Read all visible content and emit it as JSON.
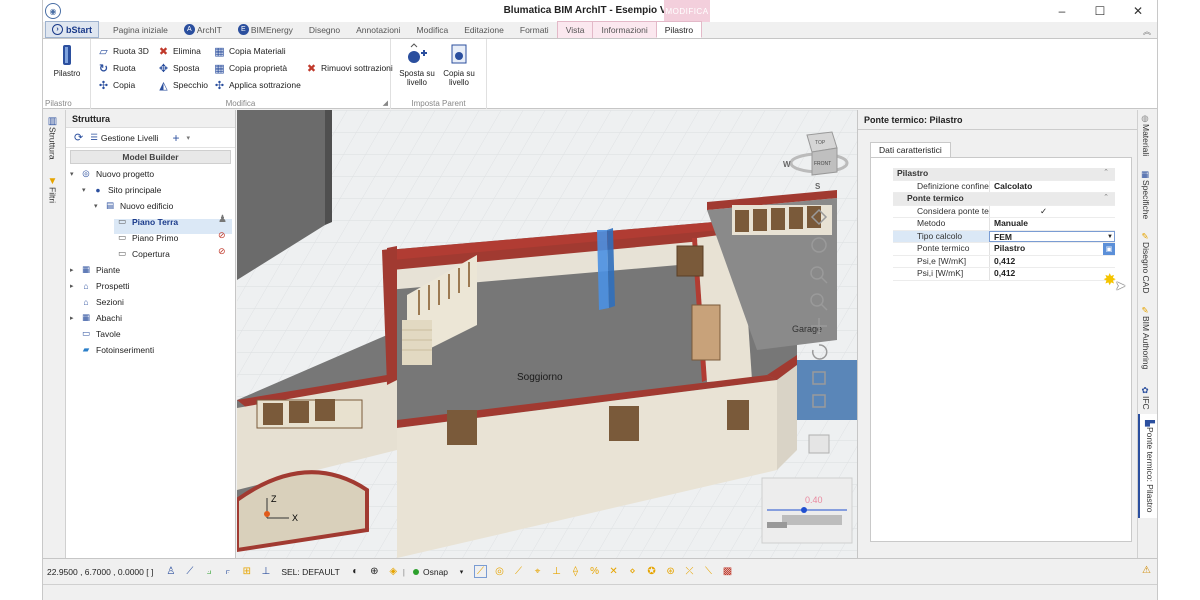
{
  "window": {
    "title": "Blumatica BIM ArchIT - Esempio Villetta*",
    "context_label": "MODIFICA",
    "controls": {
      "minimize": "–",
      "maximize": "☐",
      "close": "✕"
    }
  },
  "tabs": {
    "bstart": "bStart",
    "items": [
      "Pagina iniziale",
      "ArchIT",
      "BIMEnergy",
      "Disegno",
      "Annotazioni",
      "Modifica",
      "Editazione",
      "Formati",
      "Vista",
      "Informazioni",
      "Pilastro"
    ],
    "active": "Pilastro"
  },
  "ribbon": {
    "pilastro_group": {
      "button": "Pilastro",
      "label": "Pilastro"
    },
    "modifica_group": {
      "label": "Modifica",
      "ruota3d": "Ruota 3D",
      "ruota": "Ruota",
      "copia": "Copia",
      "elimina": "Elimina",
      "sposta": "Sposta",
      "specchio": "Specchio",
      "copia_materiali": "Copia Materiali",
      "copia_proprieta": "Copia proprietà",
      "applica_sottrazione": "Applica sottrazione",
      "rimuovi_sottrazioni": "Rimuovi sottrazioni"
    },
    "parent_group": {
      "label": "Imposta Parent",
      "sposta_livello": [
        "Sposta su",
        "livello"
      ],
      "copia_livello": [
        "Copia su",
        "livello"
      ]
    }
  },
  "left_tabs": [
    "Struttura",
    "Filtri"
  ],
  "struttura": {
    "title": "Struttura",
    "gestione_livelli": "Gestione Livelli",
    "model_builder": "Model Builder",
    "tree": {
      "nuovo_progetto": "Nuovo progetto",
      "sito_principale": "Sito principale",
      "nuovo_edificio": "Nuovo edificio",
      "piano_terra": "Piano Terra",
      "piano_primo": "Piano Primo",
      "copertura": "Copertura",
      "piante": "Piante",
      "prospetti": "Prospetti",
      "sezioni": "Sezioni",
      "abachi": "Abachi",
      "tavole": "Tavole",
      "fotoinserimenti": "Fotoinserimenti"
    }
  },
  "viewport": {
    "room_soggiorno": "Soggiorno",
    "room_garage": "Garage",
    "navcube": {
      "top": "TOP",
      "front": "FRONT",
      "w": "W",
      "s": "S"
    },
    "axis_z": "Z",
    "axis_x": "X",
    "minimap_value": "0.40"
  },
  "props": {
    "title": "Ponte termico: Pilastro",
    "subtab": "Dati caratteristici",
    "section_pilastro": "Pilastro",
    "definizione_confine": {
      "k": "Definizione confine",
      "v": "Calcolato"
    },
    "section_ponte": "Ponte termico",
    "considera": {
      "k": "Considera ponte termico",
      "v": "✓"
    },
    "metodo": {
      "k": "Metodo",
      "v": "Manuale"
    },
    "tipo_calcolo": {
      "k": "Tipo calcolo",
      "v": "FEM"
    },
    "ponte_termico": {
      "k": "Ponte termico",
      "v": "Pilastro"
    },
    "psi_e": {
      "k": "Psi,e [W/mK]",
      "v": "0,412"
    },
    "psi_i": {
      "k": "Psi,i [W/mK]",
      "v": "0,412"
    }
  },
  "right_tabs": [
    "Materiali",
    "Specifiche",
    "Disegno CAD",
    "BIM Authoring",
    "IFC",
    "Ponte termico: Pilastro"
  ],
  "statusbar": {
    "coords": "22.9500 , 6.7000 , 0.0000 [ ]",
    "sel": "SEL: DEFAULT",
    "osnap": "Osnap"
  },
  "colors": {
    "accent": "#2b4f9e",
    "context_tab": "#f3cfdc",
    "selection": "#dbe8f6",
    "wall_top": "#9e3a32",
    "floor": "#6e6e6e",
    "column": "#4a90e2"
  }
}
